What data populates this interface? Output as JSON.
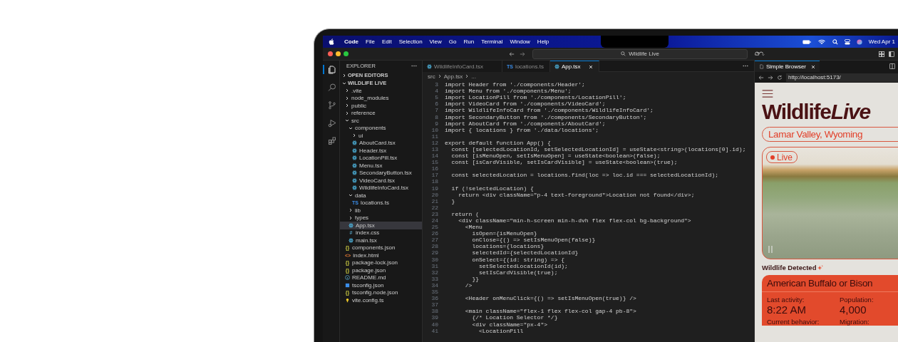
{
  "menubar": {
    "app": "Code",
    "items": [
      "File",
      "Edit",
      "Selection",
      "View",
      "Go",
      "Run",
      "Terminal",
      "Window",
      "Help"
    ],
    "clock": "Wed Apr 1"
  },
  "titlebar": {
    "search": "Wildlife Live"
  },
  "activity_bar": [
    {
      "kind": "files",
      "selected": true
    },
    {
      "kind": "search",
      "selected": false
    },
    {
      "kind": "branch",
      "selected": false
    },
    {
      "kind": "debug",
      "selected": false
    },
    {
      "kind": "extensions",
      "selected": false
    }
  ],
  "sidebar": {
    "title": "EXPLORER",
    "open_editors": {
      "label": "OPEN EDITORS",
      "expanded": false
    },
    "project": {
      "label": "WILDLIFE LIVE",
      "expanded": true,
      "items": [
        {
          "name": ".vite",
          "kind": "folder",
          "expanded": false,
          "selected": false
        },
        {
          "name": "node_modules",
          "kind": "folder",
          "expanded": false,
          "selected": false
        },
        {
          "name": "public",
          "kind": "folder",
          "expanded": false,
          "selected": false
        },
        {
          "name": "reference",
          "kind": "folder",
          "expanded": false,
          "selected": false
        },
        {
          "name": "src",
          "kind": "folder",
          "expanded": true,
          "selected": false,
          "children": [
            {
              "name": "components",
              "kind": "folder",
              "expanded": true,
              "selected": false,
              "children": [
                {
                  "name": "ui",
                  "kind": "folder",
                  "expanded": false,
                  "selected": false
                },
                {
                  "name": "AboutCard.tsx",
                  "kind": "react",
                  "selected": false
                },
                {
                  "name": "Header.tsx",
                  "kind": "react",
                  "selected": false
                },
                {
                  "name": "LocationPill.tsx",
                  "kind": "react",
                  "selected": false
                },
                {
                  "name": "Menu.tsx",
                  "kind": "react",
                  "selected": false
                },
                {
                  "name": "SecondaryButton.tsx",
                  "kind": "react",
                  "selected": false
                },
                {
                  "name": "VideoCard.tsx",
                  "kind": "react",
                  "selected": false
                },
                {
                  "name": "WildlifeInfoCard.tsx",
                  "kind": "react",
                  "selected": false
                }
              ]
            },
            {
              "name": "data",
              "kind": "folder",
              "expanded": true,
              "selected": false,
              "children": [
                {
                  "name": "locations.ts",
                  "kind": "ts",
                  "badge": "TS",
                  "selected": false
                }
              ]
            },
            {
              "name": "lib",
              "kind": "folder",
              "expanded": false,
              "selected": false
            },
            {
              "name": "types",
              "kind": "folder",
              "expanded": false,
              "selected": false
            },
            {
              "name": "App.tsx",
              "kind": "react",
              "selected": true
            },
            {
              "name": "index.css",
              "kind": "css",
              "badge": "#",
              "selected": false
            },
            {
              "name": "main.tsx",
              "kind": "react",
              "selected": false
            }
          ]
        },
        {
          "name": "components.json",
          "kind": "json",
          "badge": "{}",
          "selected": false
        },
        {
          "name": "index.html",
          "kind": "html",
          "badge": "<>",
          "selected": false
        },
        {
          "name": "package-lock.json",
          "kind": "json",
          "badge": "{}",
          "selected": false
        },
        {
          "name": "package.json",
          "kind": "json",
          "badge": "{}",
          "selected": false
        },
        {
          "name": "README.md",
          "kind": "info",
          "selected": false
        },
        {
          "name": "tsconfig.json",
          "kind": "tsconfig",
          "selected": false
        },
        {
          "name": "tsconfig.node.json",
          "kind": "json",
          "badge": "{}",
          "selected": false
        },
        {
          "name": "vite.config.ts",
          "kind": "bulb",
          "selected": false
        }
      ]
    }
  },
  "editor": {
    "tabs": [
      {
        "label": "WildlifeInfoCard.tsx",
        "kind": "react",
        "selected": false
      },
      {
        "label": "locations.ts",
        "kind": "ts",
        "badge": "TS",
        "selected": false
      },
      {
        "label": "App.tsx",
        "kind": "react",
        "selected": true
      }
    ],
    "breadcrumb": [
      "src",
      "App.tsx",
      "..."
    ],
    "lines": [
      {
        "n": "3",
        "code": "import Header from './components/Header';"
      },
      {
        "n": "4",
        "code": "import Menu from './components/Menu';"
      },
      {
        "n": "5",
        "code": "import LocationPill from './components/LocationPill';"
      },
      {
        "n": "6",
        "code": "import VideoCard from './components/VideoCard';"
      },
      {
        "n": "7",
        "code": "import WildlifeInfoCard from './components/WildlifeInfoCard';"
      },
      {
        "n": "8",
        "code": "import SecondaryButton from './components/SecondaryButton';"
      },
      {
        "n": "9",
        "code": "import AboutCard from './components/AboutCard';"
      },
      {
        "n": "10",
        "code": "import { locations } from './data/locations';"
      },
      {
        "n": "11"
      },
      {
        "n": "12",
        "code": "export default function App() {"
      },
      {
        "n": "13",
        "code": "  const [selectedLocationId, setSelectedLocationId] = useState<string>(locations[0].id);"
      },
      {
        "n": "14",
        "code": "  const [isMenuOpen, setIsMenuOpen] = useState<boolean>(false);"
      },
      {
        "n": "15",
        "code": "  const [isCardVisible, setIsCardVisible] = useState<boolean>(true);"
      },
      {
        "n": "16"
      },
      {
        "n": "17",
        "code": "  const selectedLocation = locations.find(loc => loc.id === selectedLocationId);"
      },
      {
        "n": "18"
      },
      {
        "n": "19",
        "code": "  if (!selectedLocation) {"
      },
      {
        "n": "20",
        "code": "    return <div className=\"p-4 text-foreground\">Location not found</div>;"
      },
      {
        "n": "21",
        "code": "  }"
      },
      {
        "n": "22"
      },
      {
        "n": "23",
        "code": "  return ("
      },
      {
        "n": "24",
        "code": "    <div className=\"min-h-screen min-h-dvh flex flex-col bg-background\">"
      },
      {
        "n": "25",
        "code": "      <Menu"
      },
      {
        "n": "26",
        "code": "        isOpen={isMenuOpen}"
      },
      {
        "n": "27",
        "code": "        onClose={() => setIsMenuOpen(false)}"
      },
      {
        "n": "28",
        "code": "        locations={locations}"
      },
      {
        "n": "29",
        "code": "        selectedId={selectedLocationId}"
      },
      {
        "n": "30",
        "code": "        onSelect={(id: string) => {"
      },
      {
        "n": "31",
        "code": "          setSelectedLocationId(id);"
      },
      {
        "n": "32",
        "code": "          setIsCardVisible(true);"
      },
      {
        "n": "33",
        "code": "        }}"
      },
      {
        "n": "34",
        "code": "      />"
      },
      {
        "n": "35"
      },
      {
        "n": "36",
        "code": "      <Header onMenuClick={() => setIsMenuOpen(true)} />"
      },
      {
        "n": "37"
      },
      {
        "n": "38",
        "code": "      <main className=\"flex-1 flex flex-col gap-4 pb-8\">"
      },
      {
        "n": "39",
        "code": "        {/* Location Selector */}"
      },
      {
        "n": "40",
        "code": "        <div className=\"px-4\">"
      },
      {
        "n": "41",
        "code": "          <LocationPill"
      }
    ]
  },
  "browser": {
    "tab": "Simple Browser",
    "url": "http://localhost:5173/",
    "page": {
      "title": {
        "plain": "Wildlife",
        "italic": "Live"
      },
      "location": "Lamar Valley, Wyoming",
      "live": "Live",
      "detected": "Wildlife Detected",
      "animal": {
        "name": "American Buffalo or Bison",
        "facts": [
          {
            "label": "Last activity:",
            "value": "8:22 AM"
          },
          {
            "label": "Population:",
            "value": "4,000"
          },
          {
            "label": "Current behavior:"
          },
          {
            "label": "Migration:"
          }
        ]
      }
    }
  }
}
